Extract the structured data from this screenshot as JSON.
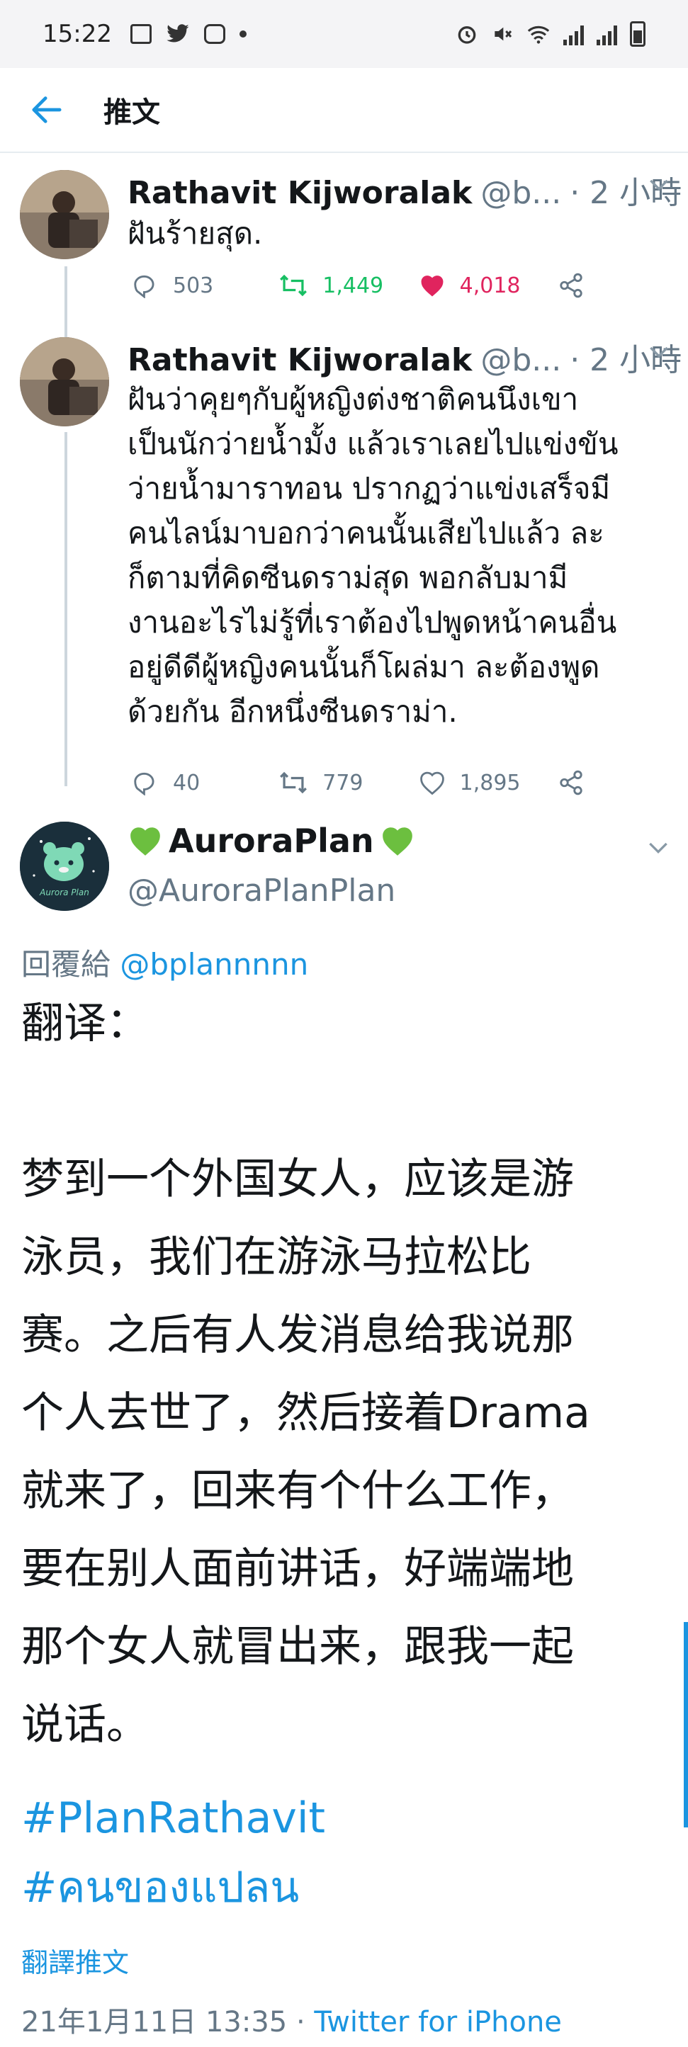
{
  "status_bar": {
    "time": "15:22"
  },
  "header": {
    "title": "推文"
  },
  "tweets": [
    {
      "name": "Rathavit Kijworalak",
      "handle": "@b...",
      "time": "· 2 小時",
      "text": "ฝันร้ายสุด.",
      "replies": "503",
      "retweets": "1,449",
      "likes": "4,018",
      "liked": true
    },
    {
      "name": "Rathavit Kijworalak",
      "handle": "@b...",
      "time": "· 2 小時",
      "text": "ฝันว่าคุยๆกับผู้หญิงต่งชาติคนนึงเขา\nเป็นนักว่ายน้ำมั้ง แล้วเราเลยไปแข่งขัน\nว่ายน้ำมาราทอน ปรากฏว่าแข่งเสร็จมี\nคนไลน์มาบอกว่าคนนั้นเสียไปแล้ว ละ\nก็ตามที่คิดซีนดราม่สุด พอกลับมามี\nงานอะไรไม่รู้ที่เราต้องไปพูดหน้าคนอื่น\nอยู่ดีดีผู้หญิงคนนั้นก็โผล่มา ละต้องพูด\nด้วยกัน อีกหนึ่งซีนดราม่า.",
      "replies": "40",
      "retweets": "779",
      "likes": "1,895",
      "liked": false
    }
  ],
  "main_tweet": {
    "name": "AuroraPlan",
    "handle": "@AuroraPlanPlan",
    "avatar_label": "Aurora Plan",
    "reply_prefix": "回覆給",
    "reply_to": "@bplannnnn",
    "text": "翻译：\n\n梦到一个外国女人，应该是游\n泳员，我们在游泳马拉松比\n赛。之后有人发消息给我说那\n个人去世了，然后接着Drama\n就来了，回来有个什么工作，\n要在别人面前讲话，好端端地\n那个女人就冒出来，跟我一起\n说话。",
    "hashtags": [
      "#PlanRathavit",
      "#คนของแปลน"
    ],
    "translate_label": "翻譯推文",
    "timestamp": "21年1月11日 13:35 · ",
    "via": "Twitter for iPhone"
  },
  "colors": {
    "accent": "#1b95e0",
    "secondary_text": "#657786",
    "like_red": "#e0245e",
    "retweet_green": "#17bf63",
    "heart_green": "#6cbf3f"
  }
}
